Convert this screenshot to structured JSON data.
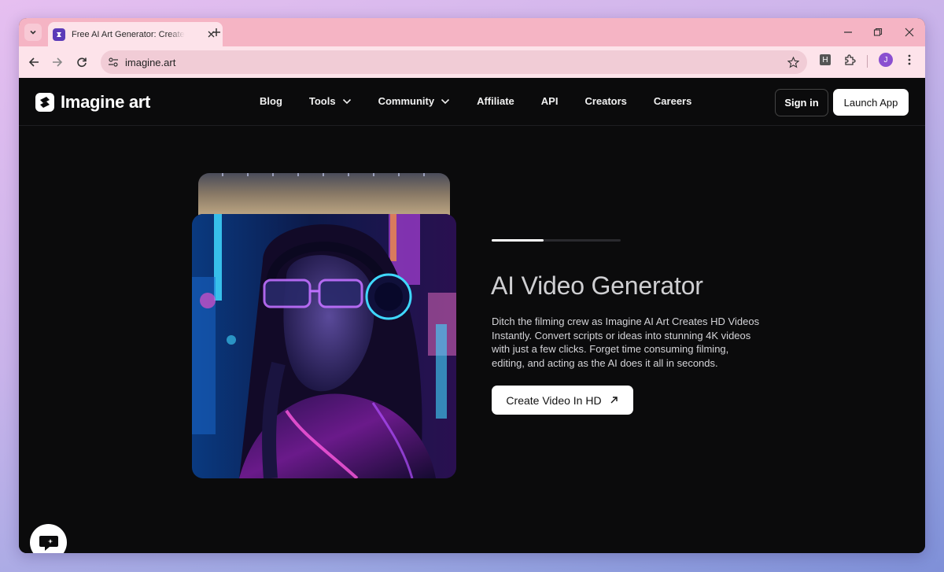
{
  "browser": {
    "tab_title": "Free AI Art Generator: Create AI Art From Text",
    "url": "imagine.art",
    "profile_initial": "J",
    "extension_letter": "H"
  },
  "site": {
    "logo_text": "Imagine art",
    "nav": [
      {
        "label": "Blog",
        "dropdown": false
      },
      {
        "label": "Tools",
        "dropdown": true
      },
      {
        "label": "Community",
        "dropdown": true
      },
      {
        "label": "Affiliate",
        "dropdown": false
      },
      {
        "label": "API",
        "dropdown": false
      },
      {
        "label": "Creators",
        "dropdown": false
      },
      {
        "label": "Careers",
        "dropdown": false
      }
    ],
    "signin_label": "Sign in",
    "launch_label": "Launch App"
  },
  "hero": {
    "slide_progress": 0.4,
    "title": "AI Video Generator",
    "description": "Ditch the filming crew as Imagine AI Art Creates HD Videos Instantly. Convert scripts or ideas into stunning 4K videos with just a few clicks. Forget time consuming filming, editing, and acting as the AI does it all in seconds.",
    "cta_label": "Create Video In HD"
  },
  "colors": {
    "tab_strip": "#f5b4c4",
    "toolbar": "#fde3ea",
    "page_bg": "#0b0b0c",
    "accent_neon_pink": "#d04cff",
    "accent_neon_cyan": "#3fd8ff"
  }
}
